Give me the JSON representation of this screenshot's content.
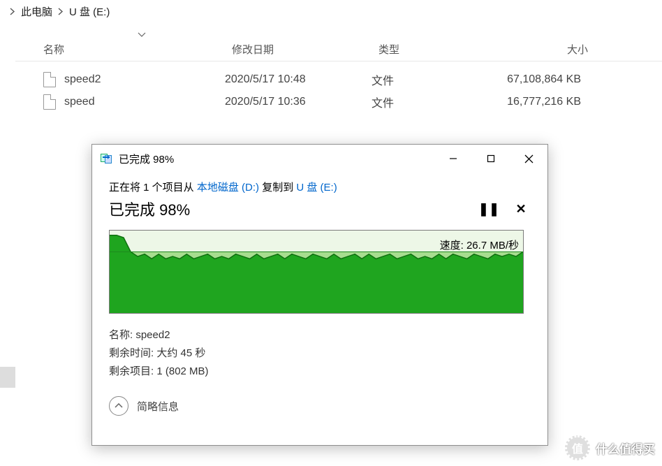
{
  "breadcrumb": {
    "items": [
      "此电脑",
      "U 盘 (E:)"
    ]
  },
  "columns": {
    "name": "名称",
    "date": "修改日期",
    "type": "类型",
    "size": "大小"
  },
  "files": [
    {
      "name": "speed2",
      "date": "2020/5/17 10:48",
      "type": "文件",
      "size": "67,108,864 KB"
    },
    {
      "name": "speed",
      "date": "2020/5/17 10:36",
      "type": "文件",
      "size": "16,777,216 KB"
    }
  ],
  "dialog": {
    "title": "已完成 98%",
    "copy_prefix": "正在将 1 个项目从 ",
    "copy_src": "本地磁盘 (D:)",
    "copy_mid": " 复制到 ",
    "copy_dst": "U 盘 (E:)",
    "progress_big": "已完成 98%",
    "pause_glyph": "❚❚",
    "cancel_glyph": "✕",
    "speed_label_prefix": "速度: ",
    "speed_value": "26.7 MB/秒",
    "name_label": "名称: ",
    "name_value": "speed2",
    "remain_time_label": "剩余时间: ",
    "remain_time_value": "大约 45 秒",
    "remain_items_label": "剩余项目: ",
    "remain_items_value": "1 (802 MB)",
    "collapse_label": "简略信息"
  },
  "watermark": {
    "badge": "值",
    "text": "什么值得买"
  },
  "chart_data": {
    "type": "area",
    "title": "",
    "xlabel": "",
    "ylabel": "",
    "ylim": [
      0,
      35
    ],
    "speed_line_value": 26.7,
    "x": [
      0,
      1,
      2,
      3,
      4,
      5,
      6,
      7,
      8,
      9,
      10,
      11,
      12,
      13,
      14,
      15,
      16,
      17,
      18,
      19,
      20,
      21,
      22,
      23,
      24,
      25,
      26,
      27,
      28,
      29,
      30,
      31,
      32,
      33,
      34,
      35,
      36,
      37,
      38,
      39,
      40,
      41,
      42,
      43,
      44,
      45,
      46,
      47,
      48,
      49,
      50,
      51,
      52,
      53,
      54,
      55,
      56,
      57,
      58,
      59
    ],
    "values": [
      33,
      33,
      32,
      26,
      24,
      25,
      23,
      25,
      23,
      24,
      23,
      25,
      23,
      24,
      25,
      23,
      24,
      23,
      25,
      24,
      23,
      25,
      23,
      24,
      25,
      23,
      25,
      24,
      23,
      25,
      24,
      23,
      25,
      23,
      24,
      25,
      23,
      25,
      23,
      24,
      25,
      23,
      24,
      25,
      23,
      24,
      23,
      25,
      23,
      25,
      24,
      23,
      25,
      24,
      23,
      25,
      24,
      25,
      24,
      26
    ]
  }
}
